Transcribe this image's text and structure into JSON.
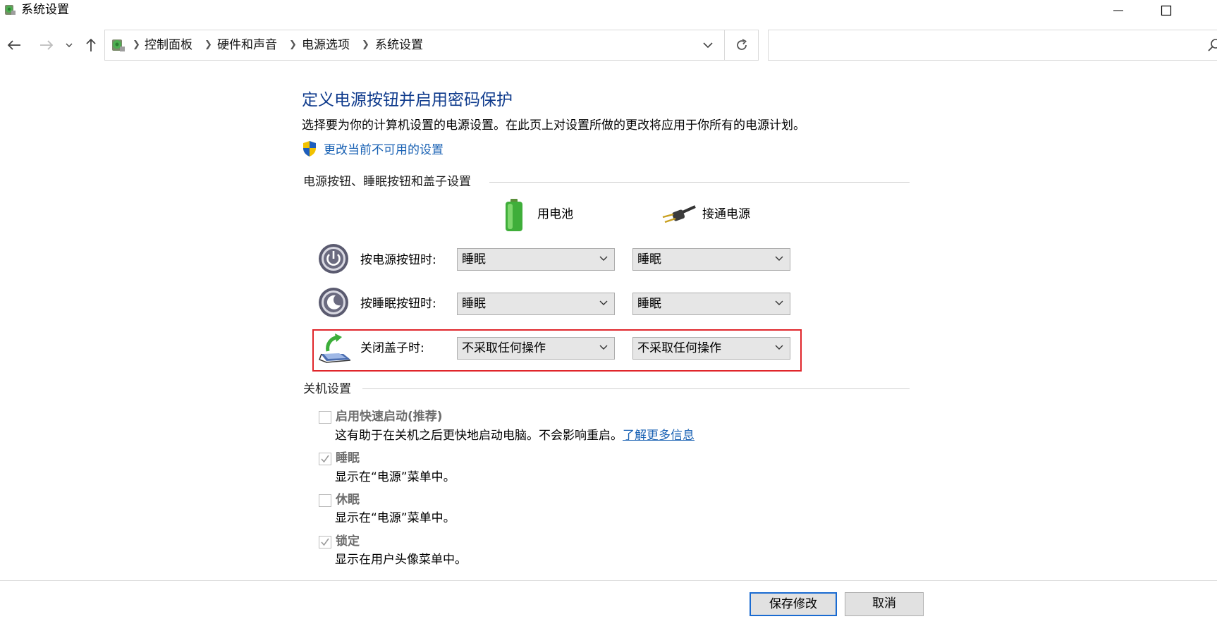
{
  "window": {
    "title": "系统设置",
    "icon": "control-panel-icon",
    "controls": [
      "minimize-icon",
      "maximize-icon",
      "close-icon"
    ]
  },
  "nav": {
    "buttons": [
      "back-icon",
      "forward-icon",
      "recent-dropdown-icon",
      "up-icon"
    ],
    "breadcrumb": [
      "控制面板",
      "硬件和声音",
      "电源选项",
      "系统设置"
    ],
    "search_placeholder": ""
  },
  "content": {
    "heading": "定义电源按钮并启用密码保护",
    "description": "选择要为你的计算机设置的电源设置。在此页上对设置所做的更改将应用于你所有的电源计划。",
    "change_unavailable_link": "更改当前不可用的设置"
  },
  "power_section": {
    "label": "电源按钮、睡眠按钮和盖子设置",
    "columns": [
      {
        "label": "用电池",
        "icon": "battery-icon"
      },
      {
        "label": "接通电源",
        "icon": "power-plug-icon"
      }
    ],
    "rows": [
      {
        "label": "按电源按钮时:",
        "icon": "power-button-icon",
        "battery": "睡眠",
        "plugged": "睡眠"
      },
      {
        "label": "按睡眠按钮时:",
        "icon": "sleep-button-icon",
        "battery": "睡眠",
        "plugged": "睡眠"
      },
      {
        "label": "关闭盖子时:",
        "icon": "laptop-lid-icon",
        "battery": "不采取任何操作",
        "plugged": "不采取任何操作"
      }
    ],
    "highlight_color": "#e0262b"
  },
  "shutdown_section": {
    "label": "关机设置",
    "items": [
      {
        "label": "启用快速启动(推荐)",
        "checked": false,
        "desc": "这有助于在关机之后更快地启动电脑。不会影响重启。",
        "link": "了解更多信息"
      },
      {
        "label": "睡眠",
        "checked": true,
        "desc": "显示在“电源”菜单中。"
      },
      {
        "label": "休眠",
        "checked": false,
        "desc": "显示在“电源”菜单中。"
      },
      {
        "label": "锁定",
        "checked": true,
        "desc": "显示在用户头像菜单中。"
      }
    ]
  },
  "footer": {
    "save_label": "保存修改",
    "cancel_label": "取消"
  },
  "colors": {
    "heading": "#0e3a8c",
    "link": "#1a62b4",
    "primary_border": "#1a6bd1"
  }
}
